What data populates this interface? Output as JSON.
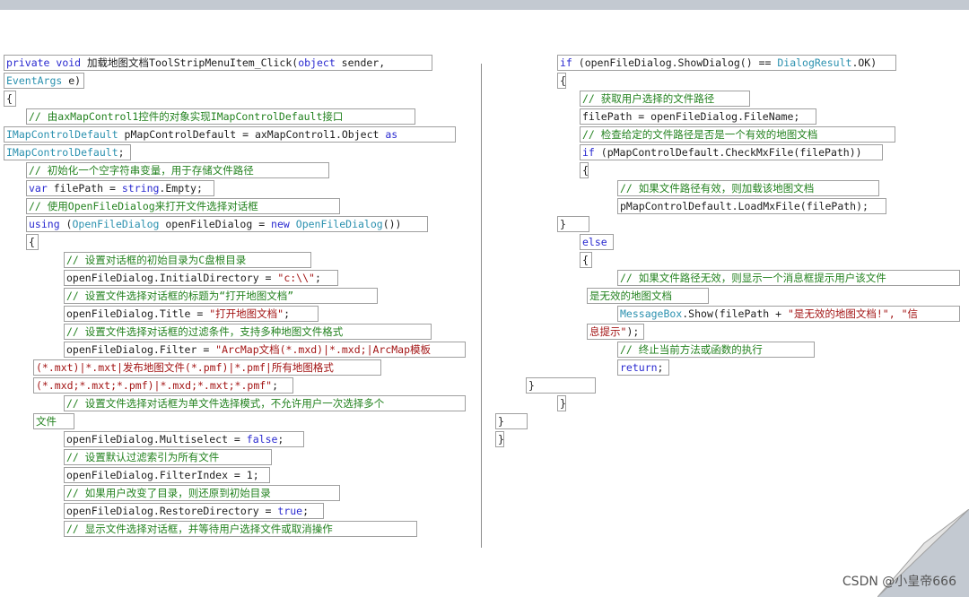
{
  "code_lines": [
    {
      "parts": [
        {
          "c": "kw",
          "t": "private"
        },
        {
          "c": "",
          "t": " "
        },
        {
          "c": "kw",
          "t": "void"
        },
        {
          "c": "",
          "t": " 加载地图文档ToolStripMenuItem_Click("
        },
        {
          "c": "kw",
          "t": "object"
        },
        {
          "c": "",
          "t": " sender, "
        }
      ]
    },
    {
      "parts": [
        {
          "c": "ty",
          "t": "EventArgs"
        },
        {
          "c": "",
          "t": " e)"
        }
      ]
    },
    {
      "parts": [
        {
          "c": "",
          "t": "{"
        }
      ]
    },
    {
      "parts": [
        {
          "c": "cm",
          "t": "// 由axMapControl1控件的对象实现IMapControlDefault接口"
        }
      ]
    },
    {
      "parts": [
        {
          "c": "ty",
          "t": "IMapControlDefault"
        },
        {
          "c": "",
          "t": " pMapControlDefault = axMapControl1.Object "
        },
        {
          "c": "kw",
          "t": "as"
        }
      ]
    },
    {
      "parts": [
        {
          "c": "ty",
          "t": "IMapControlDefault"
        },
        {
          "c": "",
          "t": ";"
        }
      ]
    },
    {
      "parts": [
        {
          "c": "cm",
          "t": "// 初始化一个空字符串变量，用于存储文件路径"
        }
      ]
    },
    {
      "parts": [
        {
          "c": "kw",
          "t": "var"
        },
        {
          "c": "",
          "t": " filePath = "
        },
        {
          "c": "kw",
          "t": "string"
        },
        {
          "c": "",
          "t": ".Empty;"
        }
      ]
    },
    {
      "parts": [
        {
          "c": "cm",
          "t": "// 使用OpenFileDialog来打开文件选择对话框"
        }
      ]
    },
    {
      "parts": [
        {
          "c": "kw",
          "t": "using"
        },
        {
          "c": "",
          "t": " ("
        },
        {
          "c": "ty",
          "t": "OpenFileDialog"
        },
        {
          "c": "",
          "t": " openFileDialog = "
        },
        {
          "c": "kw",
          "t": "new"
        },
        {
          "c": "",
          "t": " "
        },
        {
          "c": "ty",
          "t": "OpenFileDialog"
        },
        {
          "c": "",
          "t": "())"
        }
      ]
    },
    {
      "parts": [
        {
          "c": "",
          "t": "{"
        }
      ]
    },
    {
      "parts": [
        {
          "c": "cm",
          "t": "// 设置对话框的初始目录为C盘根目录"
        }
      ]
    },
    {
      "parts": [
        {
          "c": "",
          "t": "openFileDialog.InitialDirectory = "
        },
        {
          "c": "st",
          "t": "\"c:\\\\\""
        },
        {
          "c": "",
          "t": ";"
        }
      ]
    },
    {
      "parts": [
        {
          "c": "cm",
          "t": "// 设置文件选择对话框的标题为“打开地图文档”"
        }
      ]
    },
    {
      "parts": [
        {
          "c": "",
          "t": "openFileDialog.Title = "
        },
        {
          "c": "st",
          "t": "\"打开地图文档\""
        },
        {
          "c": "",
          "t": ";"
        }
      ]
    },
    {
      "parts": [
        {
          "c": "cm",
          "t": "// 设置文件选择对话框的过滤条件，支持多种地图文件格式"
        }
      ]
    },
    {
      "parts": [
        {
          "c": "",
          "t": "openFileDialog.Filter = "
        },
        {
          "c": "st",
          "t": "\"ArcMap文档(*.mxd)|*.mxd;|ArcMap模板"
        }
      ]
    },
    {
      "parts": [
        {
          "c": "st",
          "t": "(*.mxt)|*.mxt|发布地图文件(*.pmf)|*.pmf|所有地图格式"
        }
      ]
    },
    {
      "parts": [
        {
          "c": "st",
          "t": "(*.mxd;*.mxt;*.pmf)|*.mxd;*.mxt;*.pmf\""
        },
        {
          "c": "",
          "t": ";"
        }
      ]
    },
    {
      "parts": [
        {
          "c": "cm",
          "t": "// 设置文件选择对话框为单文件选择模式，不允许用户一次选择多个"
        }
      ]
    },
    {
      "parts": [
        {
          "c": "cm",
          "t": "文件"
        }
      ]
    },
    {
      "parts": [
        {
          "c": "",
          "t": "openFileDialog.Multiselect = "
        },
        {
          "c": "kw",
          "t": "false"
        },
        {
          "c": "",
          "t": ";"
        }
      ]
    },
    {
      "parts": [
        {
          "c": "cm",
          "t": "// 设置默认过滤索引为所有文件"
        }
      ]
    },
    {
      "parts": [
        {
          "c": "",
          "t": "openFileDialog.FilterIndex = 1;"
        }
      ]
    },
    {
      "parts": [
        {
          "c": "cm",
          "t": "// 如果用户改变了目录，则还原到初始目录"
        }
      ]
    },
    {
      "parts": [
        {
          "c": "",
          "t": "openFileDialog.RestoreDirectory = "
        },
        {
          "c": "kw",
          "t": "true"
        },
        {
          "c": "",
          "t": ";"
        }
      ]
    },
    {
      "parts": [
        {
          "c": "cm",
          "t": "// 显示文件选择对话框，并等待用户选择文件或取消操作"
        }
      ]
    },
    {
      "parts": [
        {
          "c": "kw",
          "t": "if"
        },
        {
          "c": "",
          "t": " (openFileDialog.ShowDialog() == "
        },
        {
          "c": "ty",
          "t": "DialogResult"
        },
        {
          "c": "",
          "t": ".OK)"
        }
      ]
    },
    {
      "parts": [
        {
          "c": "",
          "t": "{"
        }
      ]
    },
    {
      "parts": [
        {
          "c": "cm",
          "t": "// 获取用户选择的文件路径"
        }
      ]
    },
    {
      "parts": [
        {
          "c": "",
          "t": "filePath = openFileDialog.FileName;"
        }
      ]
    },
    {
      "parts": [
        {
          "c": "cm",
          "t": "// 检查给定的文件路径是否是一个有效的地图文档"
        }
      ]
    },
    {
      "parts": [
        {
          "c": "kw",
          "t": "if"
        },
        {
          "c": "",
          "t": " (pMapControlDefault.CheckMxFile(filePath))"
        }
      ]
    },
    {
      "parts": [
        {
          "c": "",
          "t": "{"
        }
      ]
    },
    {
      "parts": [
        {
          "c": "cm",
          "t": "// 如果文件路径有效，则加载该地图文档"
        }
      ]
    },
    {
      "parts": [
        {
          "c": "",
          "t": "pMapControlDefault.LoadMxFile(filePath);"
        }
      ]
    },
    {
      "parts": [
        {
          "c": "",
          "t": "}"
        }
      ]
    },
    {
      "parts": [
        {
          "c": "kw",
          "t": "else"
        }
      ]
    },
    {
      "parts": [
        {
          "c": "",
          "t": "{"
        }
      ]
    },
    {
      "parts": [
        {
          "c": "cm",
          "t": "// 如果文件路径无效，则显示一个消息框提示用户该文件"
        }
      ]
    },
    {
      "parts": [
        {
          "c": "cm",
          "t": "是无效的地图文档"
        }
      ]
    },
    {
      "parts": [
        {
          "c": "ty",
          "t": "MessageBox"
        },
        {
          "c": "",
          "t": ".Show(filePath + "
        },
        {
          "c": "st",
          "t": "\"是无效的地图文档!\", \"信"
        }
      ]
    },
    {
      "parts": [
        {
          "c": "st",
          "t": "息提示\""
        },
        {
          "c": "",
          "t": ");"
        }
      ]
    },
    {
      "parts": [
        {
          "c": "cm",
          "t": "// 终止当前方法或函数的执行"
        }
      ]
    },
    {
      "parts": [
        {
          "c": "kw",
          "t": "return"
        },
        {
          "c": "",
          "t": ";"
        }
      ]
    },
    {
      "parts": [
        {
          "c": "",
          "t": "}"
        }
      ]
    },
    {
      "parts": [
        {
          "c": "",
          "t": "}"
        }
      ]
    },
    {
      "parts": [
        {
          "c": "",
          "t": "}"
        }
      ]
    },
    {
      "parts": [
        {
          "c": "",
          "t": "}"
        }
      ]
    }
  ],
  "watermark": "CSDN @小皇帝666"
}
